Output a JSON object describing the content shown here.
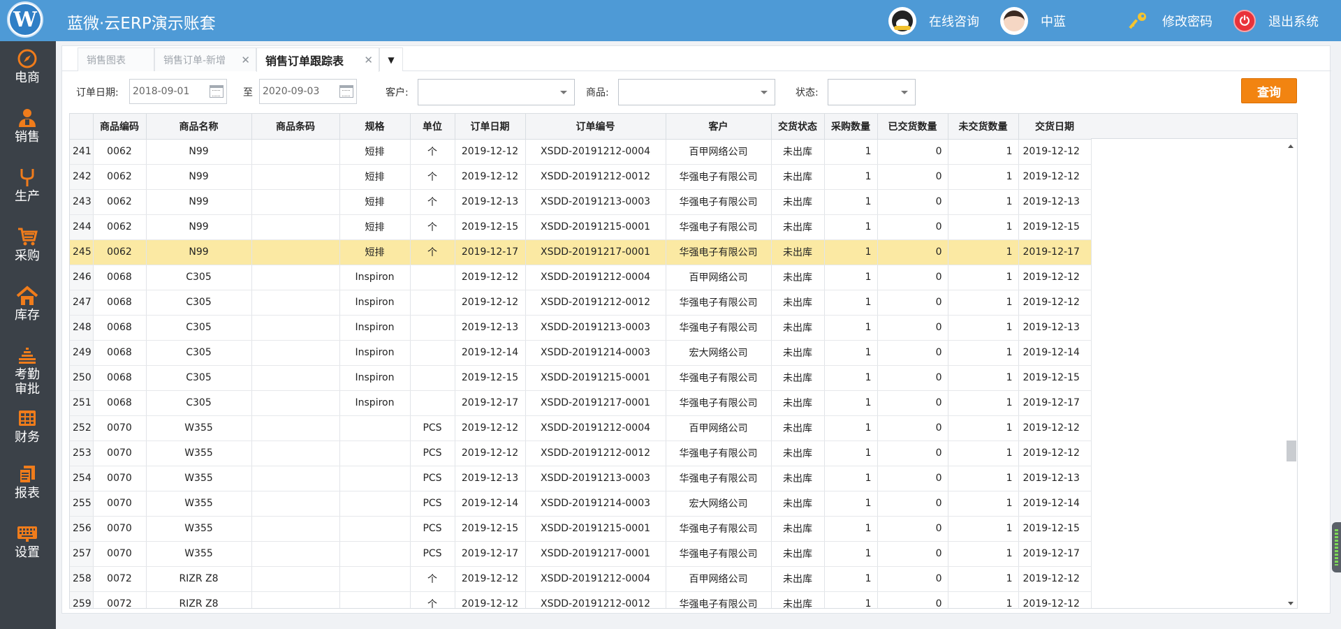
{
  "header": {
    "title": "蓝微·云ERP演示账套",
    "consult_label": "在线咨询",
    "user_name": "中蓝",
    "change_password_label": "修改密码",
    "logout_label": "退出系统"
  },
  "sidebar": {
    "items": [
      {
        "label": "电商",
        "icon": "compass-icon"
      },
      {
        "label": "销售",
        "icon": "salesperson-icon"
      },
      {
        "label": "生产",
        "icon": "fork-icon"
      },
      {
        "label": "采购",
        "icon": "cart-icon"
      },
      {
        "label": "库存",
        "icon": "home-icon"
      },
      {
        "label": "考勤",
        "label2": "审批",
        "icon": "equalizer-icon"
      },
      {
        "label": "财务",
        "icon": "calculator-icon"
      },
      {
        "label": "报表",
        "icon": "report-icon"
      },
      {
        "label": "设置",
        "icon": "keyboard-icon"
      }
    ],
    "icon_color": "#f07c1b"
  },
  "tabs": [
    {
      "label": "销售图表",
      "active": false
    },
    {
      "label": "销售订单-新增",
      "active": false
    },
    {
      "label": "销售订单跟踪表",
      "active": true
    }
  ],
  "filters": {
    "order_date_label": "订单日期:",
    "date_from": "2018-09-01",
    "to_label": "至",
    "date_to": "2020-09-03",
    "customer_label": "客户:",
    "product_label": "商品:",
    "status_label": "状态:",
    "query_button": "查询"
  },
  "table": {
    "columns": [
      "",
      "商品编码",
      "商品名称",
      "商品条码",
      "规格",
      "单位",
      "订单日期",
      "订单编号",
      "客户",
      "交货状态",
      "采购数量",
      "已交货数量",
      "未交货数量",
      "交货日期"
    ],
    "selected_row": 245,
    "rows": [
      [
        "241",
        "0062",
        "N99",
        "",
        "短排",
        "个",
        "2019-12-12",
        "XSDD-20191212-0004",
        "百甲网络公司",
        "未出库",
        "1",
        "0",
        "1",
        "2019-12-12"
      ],
      [
        "242",
        "0062",
        "N99",
        "",
        "短排",
        "个",
        "2019-12-12",
        "XSDD-20191212-0012",
        "华强电子有限公司",
        "未出库",
        "1",
        "0",
        "1",
        "2019-12-12"
      ],
      [
        "243",
        "0062",
        "N99",
        "",
        "短排",
        "个",
        "2019-12-13",
        "XSDD-20191213-0003",
        "华强电子有限公司",
        "未出库",
        "1",
        "0",
        "1",
        "2019-12-13"
      ],
      [
        "244",
        "0062",
        "N99",
        "",
        "短排",
        "个",
        "2019-12-15",
        "XSDD-20191215-0001",
        "华强电子有限公司",
        "未出库",
        "1",
        "0",
        "1",
        "2019-12-15"
      ],
      [
        "245",
        "0062",
        "N99",
        "",
        "短排",
        "个",
        "2019-12-17",
        "XSDD-20191217-0001",
        "华强电子有限公司",
        "未出库",
        "1",
        "0",
        "1",
        "2019-12-17"
      ],
      [
        "246",
        "0068",
        "C305",
        "",
        "Inspiron",
        "",
        "2019-12-12",
        "XSDD-20191212-0004",
        "百甲网络公司",
        "未出库",
        "1",
        "0",
        "1",
        "2019-12-12"
      ],
      [
        "247",
        "0068",
        "C305",
        "",
        "Inspiron",
        "",
        "2019-12-12",
        "XSDD-20191212-0012",
        "华强电子有限公司",
        "未出库",
        "1",
        "0",
        "1",
        "2019-12-12"
      ],
      [
        "248",
        "0068",
        "C305",
        "",
        "Inspiron",
        "",
        "2019-12-13",
        "XSDD-20191213-0003",
        "华强电子有限公司",
        "未出库",
        "1",
        "0",
        "1",
        "2019-12-13"
      ],
      [
        "249",
        "0068",
        "C305",
        "",
        "Inspiron",
        "",
        "2019-12-14",
        "XSDD-20191214-0003",
        "宏大网络公司",
        "未出库",
        "1",
        "0",
        "1",
        "2019-12-14"
      ],
      [
        "250",
        "0068",
        "C305",
        "",
        "Inspiron",
        "",
        "2019-12-15",
        "XSDD-20191215-0001",
        "华强电子有限公司",
        "未出库",
        "1",
        "0",
        "1",
        "2019-12-15"
      ],
      [
        "251",
        "0068",
        "C305",
        "",
        "Inspiron",
        "",
        "2019-12-17",
        "XSDD-20191217-0001",
        "华强电子有限公司",
        "未出库",
        "1",
        "0",
        "1",
        "2019-12-17"
      ],
      [
        "252",
        "0070",
        "W355",
        "",
        "",
        "PCS",
        "2019-12-12",
        "XSDD-20191212-0004",
        "百甲网络公司",
        "未出库",
        "1",
        "0",
        "1",
        "2019-12-12"
      ],
      [
        "253",
        "0070",
        "W355",
        "",
        "",
        "PCS",
        "2019-12-12",
        "XSDD-20191212-0012",
        "华强电子有限公司",
        "未出库",
        "1",
        "0",
        "1",
        "2019-12-12"
      ],
      [
        "254",
        "0070",
        "W355",
        "",
        "",
        "PCS",
        "2019-12-13",
        "XSDD-20191213-0003",
        "华强电子有限公司",
        "未出库",
        "1",
        "0",
        "1",
        "2019-12-13"
      ],
      [
        "255",
        "0070",
        "W355",
        "",
        "",
        "PCS",
        "2019-12-14",
        "XSDD-20191214-0003",
        "宏大网络公司",
        "未出库",
        "1",
        "0",
        "1",
        "2019-12-14"
      ],
      [
        "256",
        "0070",
        "W355",
        "",
        "",
        "PCS",
        "2019-12-15",
        "XSDD-20191215-0001",
        "华强电子有限公司",
        "未出库",
        "1",
        "0",
        "1",
        "2019-12-15"
      ],
      [
        "257",
        "0070",
        "W355",
        "",
        "",
        "PCS",
        "2019-12-17",
        "XSDD-20191217-0001",
        "华强电子有限公司",
        "未出库",
        "1",
        "0",
        "1",
        "2019-12-17"
      ],
      [
        "258",
        "0072",
        "RIZR Z8",
        "",
        "",
        "个",
        "2019-12-12",
        "XSDD-20191212-0004",
        "百甲网络公司",
        "未出库",
        "1",
        "0",
        "1",
        "2019-12-12"
      ],
      [
        "259",
        "0072",
        "RIZR Z8",
        "",
        "",
        "个",
        "2019-12-12",
        "XSDD-20191212-0012",
        "华强电子有限公司",
        "未出库",
        "1",
        "0",
        "1",
        "2019-12-12"
      ]
    ]
  },
  "colors": {
    "header_bg": "#4e9ad6",
    "sidebar_bg": "#3b4148",
    "accent_orange": "#f28411",
    "selected_row": "#fbe9a3"
  }
}
